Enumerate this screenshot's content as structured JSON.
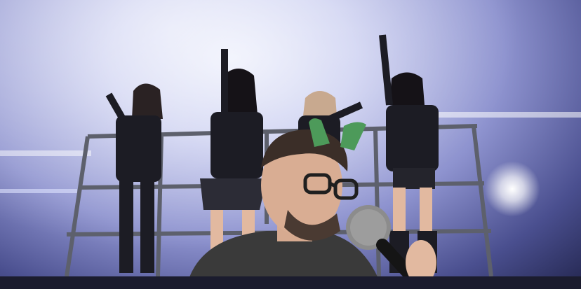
{
  "scene": {
    "description_colors": {
      "sky": "#c9cdf0",
      "scaffold": "#6b6e7a",
      "outfit": "#1c1c24",
      "skin": "#e2b9a0",
      "ears": "#4d9a5a",
      "shirt": "#3a3a3a",
      "mic": "#8c8c8c"
    }
  }
}
